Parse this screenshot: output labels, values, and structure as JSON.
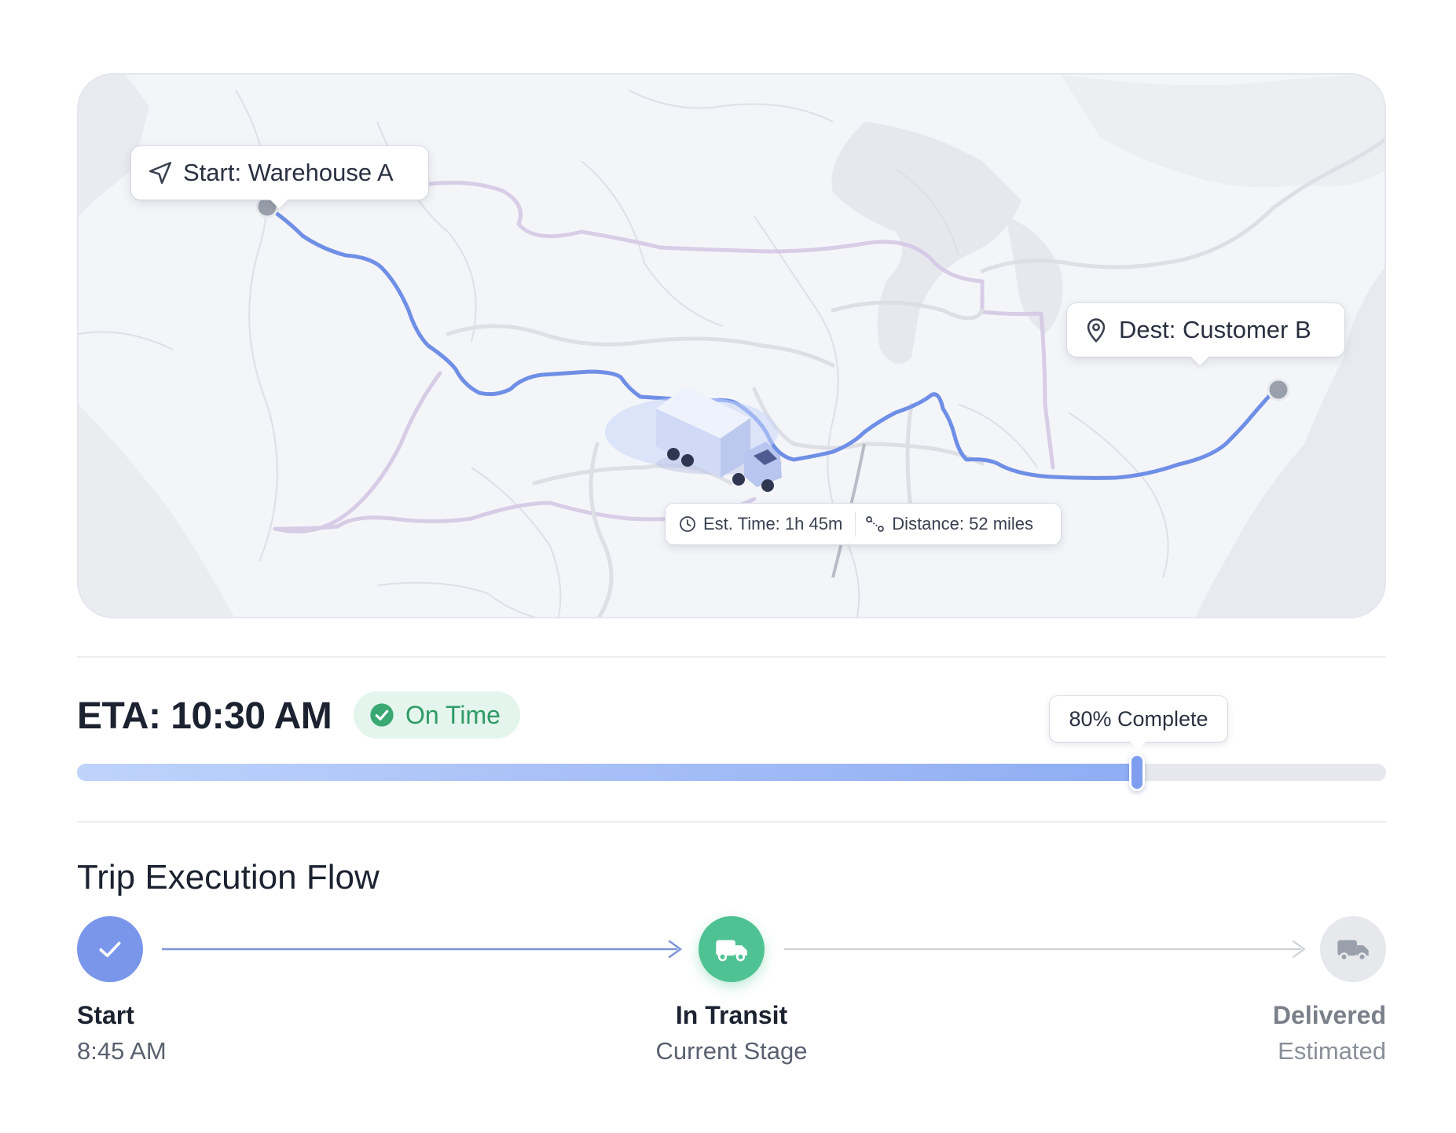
{
  "map": {
    "start_label": "Start: Warehouse A",
    "dest_label": "Dest: Customer B",
    "est_time": "Est. Time: 1h 45m",
    "distance": "Distance: 52 miles",
    "icons": {
      "start": "navigation-arrow-icon",
      "dest": "map-pin-icon",
      "time": "clock-icon",
      "distance": "route-icon",
      "vehicle": "truck-icon"
    },
    "route_color": "#6f8fe6",
    "road_color": "#cfc3e0"
  },
  "eta": {
    "title": "ETA: 10:30 AM",
    "status": "On Time",
    "status_color": "#2e9a66",
    "progress_label": "80% Complete",
    "progress_fraction": 0.81
  },
  "flow": {
    "title": "Trip Execution Flow",
    "steps": [
      {
        "label": "Start",
        "sub": "8:45 AM",
        "icon": "check-icon",
        "color": "#7a96ea"
      },
      {
        "label": "In Transit",
        "sub": "Current Stage",
        "icon": "truck-icon",
        "color": "#4fc293"
      },
      {
        "label": "Delivered",
        "sub": "Estimated",
        "icon": "truck-icon",
        "color": "#e6e8ec"
      }
    ]
  }
}
